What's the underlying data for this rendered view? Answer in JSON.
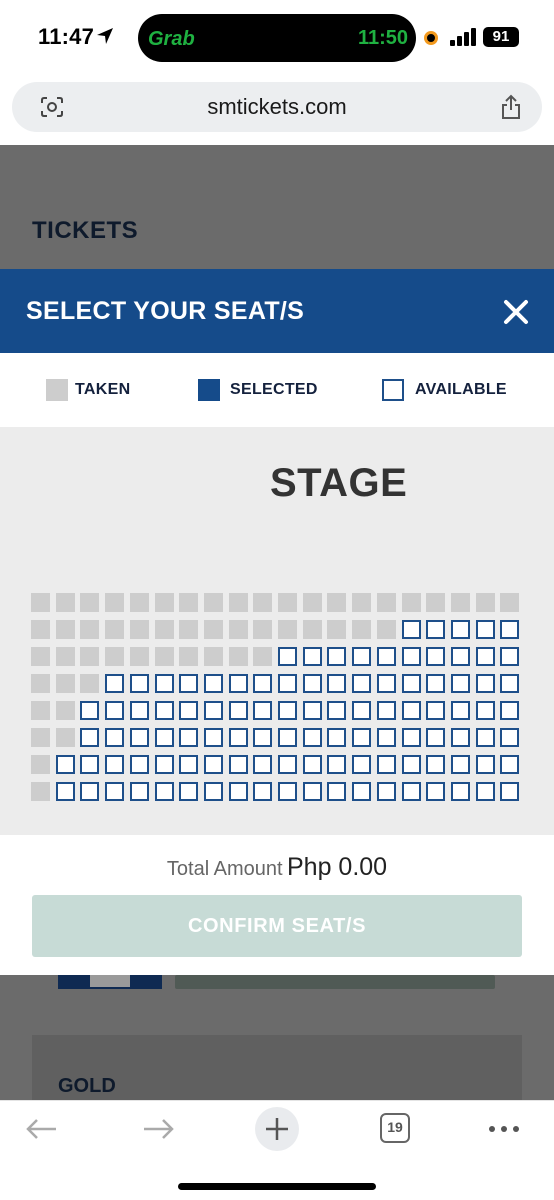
{
  "status_bar": {
    "time": "11:47",
    "island_app": "Grab",
    "island_time": "11:50",
    "battery": "91"
  },
  "browser": {
    "url": "smtickets.com",
    "tab_count": "19"
  },
  "background_page": {
    "section_title": "TICKETS",
    "tier_label": "GOLD"
  },
  "modal": {
    "title": "SELECT YOUR SEAT/S",
    "legend": {
      "taken": "TAKEN",
      "selected": "SELECTED",
      "available": "AVAILABLE"
    },
    "stage_label": "STAGE",
    "seat_map": {
      "columns": 20,
      "rows": [
        {
          "taken": 20,
          "available": 0
        },
        {
          "taken": 15,
          "available": 5
        },
        {
          "taken": 10,
          "available": 10
        },
        {
          "taken": 3,
          "available": 17
        },
        {
          "taken": 2,
          "available": 18
        },
        {
          "taken": 2,
          "available": 18
        },
        {
          "taken": 1,
          "available": 19
        },
        {
          "taken": 1,
          "available": 19
        }
      ],
      "selected_count": 0
    },
    "total_label": "Total Amount",
    "total_value": "Php 0.00",
    "confirm_label": "CONFIRM SEAT/S"
  },
  "colors": {
    "header_blue": "#154b8a",
    "taken_gray": "#cdcdcd",
    "confirm_disabled": "#c7dbd6"
  }
}
